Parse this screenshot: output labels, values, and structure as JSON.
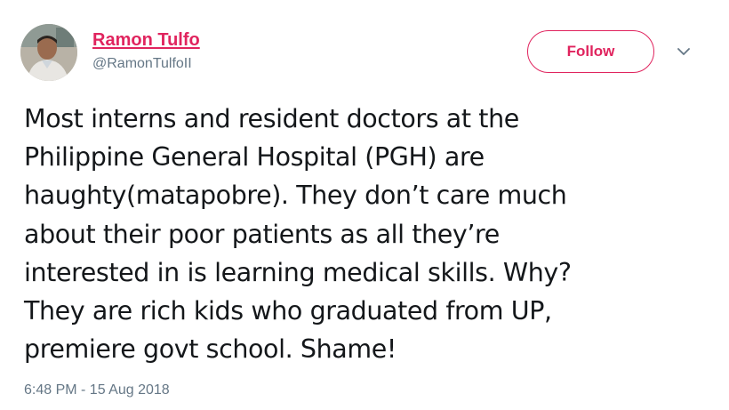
{
  "author": {
    "display_name": "Ramon Tulfo",
    "handle": "@RamonTulfoII"
  },
  "actions": {
    "follow_label": "Follow",
    "more_icon": "chevron-down-icon"
  },
  "tweet": {
    "lines": [
      "Most interns and resident doctors at the",
      "Philippine General Hospital (PGH) are",
      "haughty(matapobre). They don’t care much",
      "about their poor patients as all they’re",
      "interested in is learning medical skills. Why?",
      "They are rich kids who graduated from UP,",
      "premiere govt school. Shame!"
    ],
    "timestamp": "6:48 PM - 15 Aug 2018"
  },
  "colors": {
    "accent": "#e0245e",
    "text": "#14171a",
    "secondary": "#657786"
  }
}
